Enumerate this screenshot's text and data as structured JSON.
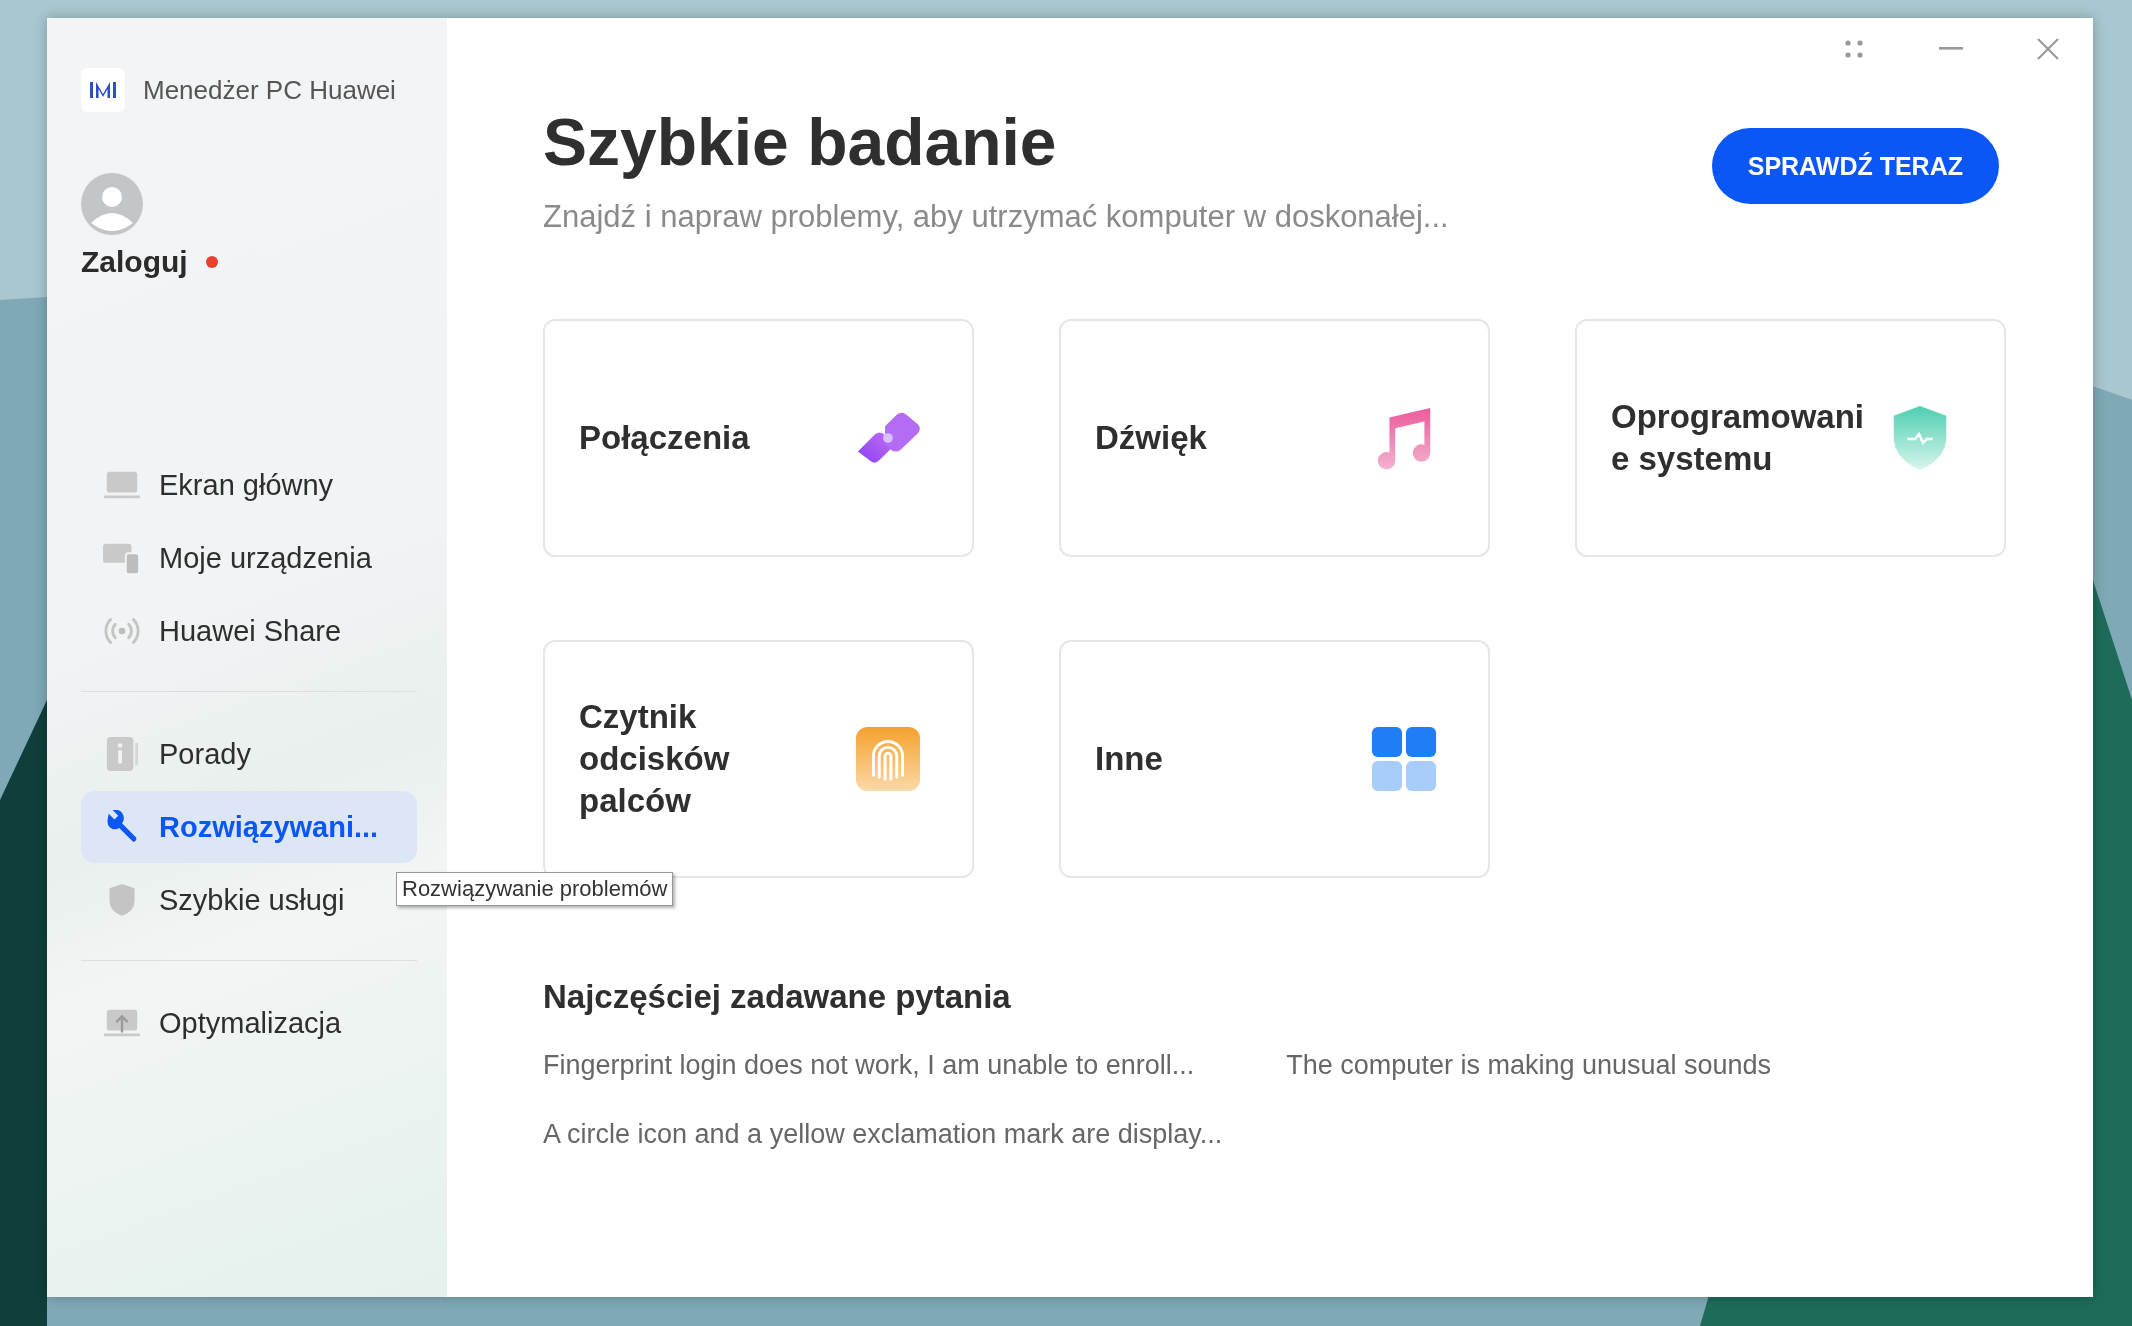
{
  "app": {
    "title": "Menedżer PC Huawei"
  },
  "user": {
    "label": "Zaloguj",
    "notification": true
  },
  "nav": [
    [
      {
        "label": "Ekran główny",
        "selected": false
      },
      {
        "label": "Moje urządzenia",
        "selected": false
      },
      {
        "label": "Huawei Share",
        "selected": false
      }
    ],
    [
      {
        "label": "Porady",
        "selected": false
      },
      {
        "label": "Rozwiązywani...",
        "selected": true
      },
      {
        "label": "Szybkie usługi",
        "selected": false
      }
    ],
    [
      {
        "label": "Optymalizacja",
        "selected": false
      }
    ]
  ],
  "tooltip": "Rozwiązywanie problemów",
  "header": {
    "title": "Szybkie badanie",
    "subtitle": "Znajdź i napraw problemy, aby utrzymać komputer w doskonałej...",
    "button": "SPRAWDŹ TERAZ"
  },
  "categories": [
    {
      "label": "Połączenia"
    },
    {
      "label": "Dźwięk"
    },
    {
      "label": "Oprogramowanie systemu"
    },
    {
      "label": "Czytnik odcisków palców"
    },
    {
      "label": "Inne"
    }
  ],
  "faq": {
    "title": "Najczęściej zadawane pytania",
    "items": [
      "Fingerprint login does not work, I am unable to enroll...",
      "The computer is making unusual sounds",
      "A circle icon and a yellow exclamation mark are display..."
    ]
  }
}
